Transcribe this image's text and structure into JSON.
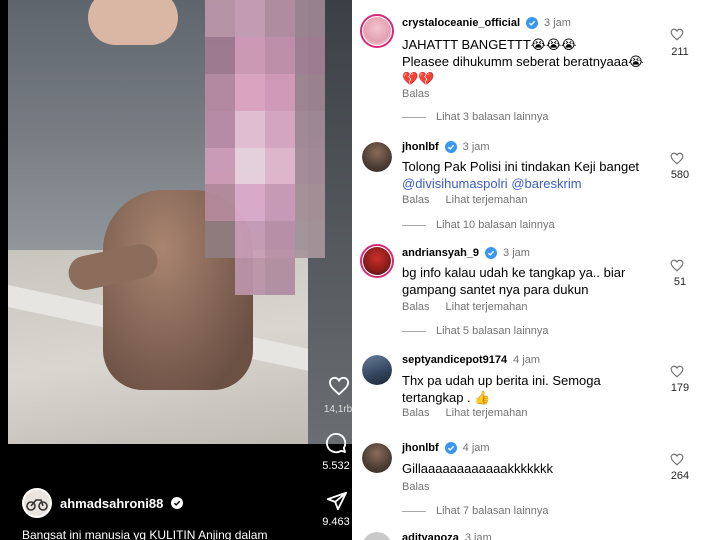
{
  "post": {
    "like_count": "14,1rb",
    "comment_count": "5.532",
    "share_count": "9.463",
    "author": "ahmadsahroni88",
    "caption": "Bangsat ini manusia yg KULITIN Anjing dalam"
  },
  "comments": [
    {
      "user": "crystaloceanie_official",
      "verified": true,
      "time": "3 jam",
      "lines": [
        "JAHATTT BANGETTT😭😭😭",
        "Pleasee dihukumm seberat beratnyaaa😭",
        "💔💔"
      ],
      "actions": [
        "Balas"
      ],
      "more": "Lihat 3 balasan lainnya",
      "likes": "211"
    },
    {
      "user": "jhonlbf",
      "verified": true,
      "time": "3 jam",
      "lines": [
        "Tolong Pak Polisi ini tindakan Keji banget"
      ],
      "mentions": [
        "@divisihumaspolri",
        "@bareskrim"
      ],
      "actions": [
        "Balas",
        "Lihat terjemahan"
      ],
      "more": "Lihat 10 balasan lainnya",
      "likes": "580"
    },
    {
      "user": "andriansyah_9",
      "verified": true,
      "time": "3 jam",
      "lines": [
        "bg info kalau udah ke tangkap ya.. biar",
        "gampang santet nya para dukun"
      ],
      "actions": [
        "Balas",
        "Lihat terjemahan"
      ],
      "more": "Lihat 5 balasan lainnya",
      "likes": "51"
    },
    {
      "user": "septyandicepot9174",
      "verified": false,
      "time": "4 jam",
      "lines": [
        "Thx pa udah up berita ini. Semoga",
        "tertangkap . 👍"
      ],
      "actions": [
        "Balas",
        "Lihat terjemahan"
      ],
      "likes": "179"
    },
    {
      "user": "jhonlbf",
      "verified": true,
      "time": "4 jam",
      "lines": [
        "Gillaaaaaaaaaaaakkkkkkk"
      ],
      "actions": [
        "Balas"
      ],
      "more": "Lihat 7 balasan lainnya",
      "likes": "264"
    },
    {
      "user": "adityapoza",
      "time": "3 jam"
    }
  ],
  "colors": {
    "verified": "#3897f0",
    "link": "#3a5ccc",
    "muted": "#737373"
  }
}
